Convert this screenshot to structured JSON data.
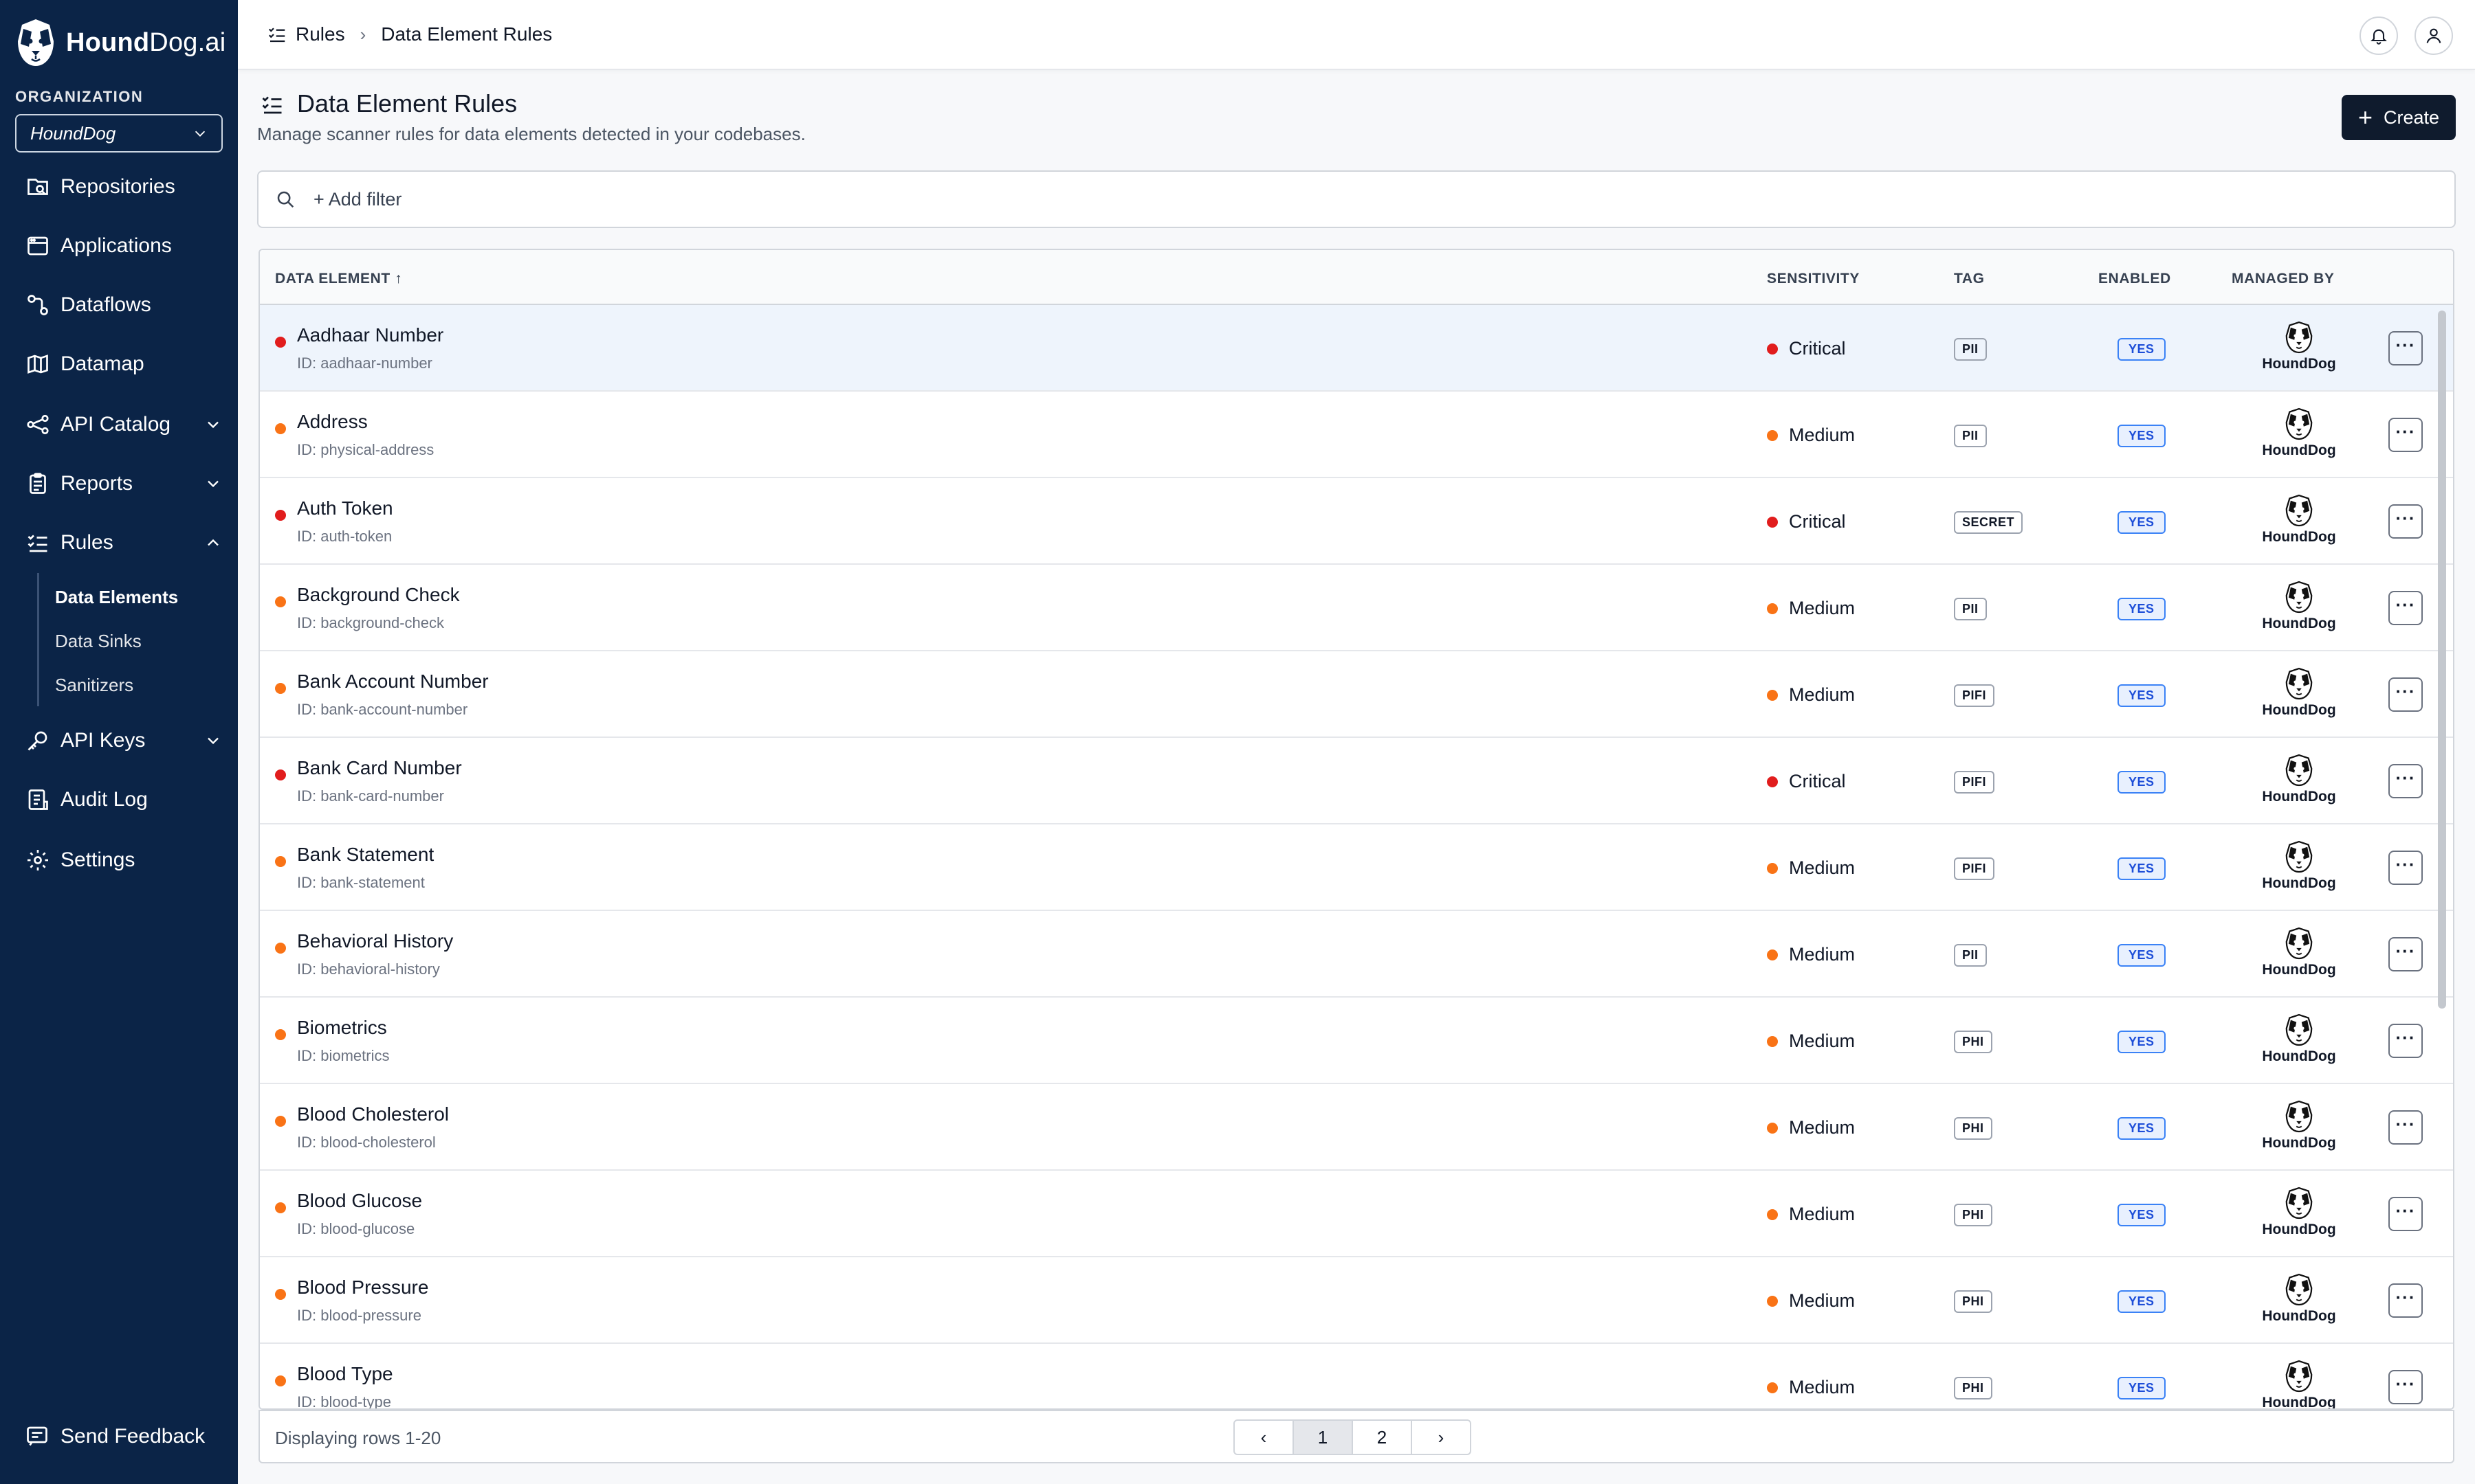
{
  "brand": {
    "name_bold": "Hound",
    "name_rest": "Dog.ai"
  },
  "org": {
    "label": "ORGANIZATION",
    "selected": "HoundDog"
  },
  "nav": [
    {
      "label": "Repositories"
    },
    {
      "label": "Applications"
    },
    {
      "label": "Dataflows"
    },
    {
      "label": "Datamap"
    },
    {
      "label": "API Catalog"
    },
    {
      "label": "Reports"
    },
    {
      "label": "Rules"
    },
    {
      "label": "API Keys"
    },
    {
      "label": "Audit Log"
    },
    {
      "label": "Settings"
    }
  ],
  "rules_sub": [
    {
      "label": "Data Elements"
    },
    {
      "label": "Data Sinks"
    },
    {
      "label": "Sanitizers"
    }
  ],
  "feedback": "Send Feedback",
  "breadcrumb": {
    "root": "Rules",
    "current": "Data Element Rules"
  },
  "page": {
    "title": "Data Element Rules",
    "subtitle": "Manage scanner rules for data elements detected in your codebases.",
    "create_label": "Create",
    "filter_placeholder": "+ Add filter"
  },
  "table": {
    "columns": [
      "DATA ELEMENT",
      "SENSITIVITY",
      "TAG",
      "ENABLED",
      "MANAGED BY"
    ],
    "rows": [
      {
        "name": "Aadhaar Number",
        "id": "ID: aadhaar-number",
        "sensitivity": "Critical",
        "tag": "PII",
        "enabled": "YES",
        "managed_by": "HoundDog"
      },
      {
        "name": "Address",
        "id": "ID: physical-address",
        "sensitivity": "Medium",
        "tag": "PII",
        "enabled": "YES",
        "managed_by": "HoundDog"
      },
      {
        "name": "Auth Token",
        "id": "ID: auth-token",
        "sensitivity": "Critical",
        "tag": "SECRET",
        "enabled": "YES",
        "managed_by": "HoundDog"
      },
      {
        "name": "Background Check",
        "id": "ID: background-check",
        "sensitivity": "Medium",
        "tag": "PII",
        "enabled": "YES",
        "managed_by": "HoundDog"
      },
      {
        "name": "Bank Account Number",
        "id": "ID: bank-account-number",
        "sensitivity": "Medium",
        "tag": "PIFI",
        "enabled": "YES",
        "managed_by": "HoundDog"
      },
      {
        "name": "Bank Card Number",
        "id": "ID: bank-card-number",
        "sensitivity": "Critical",
        "tag": "PIFI",
        "enabled": "YES",
        "managed_by": "HoundDog"
      },
      {
        "name": "Bank Statement",
        "id": "ID: bank-statement",
        "sensitivity": "Medium",
        "tag": "PIFI",
        "enabled": "YES",
        "managed_by": "HoundDog"
      },
      {
        "name": "Behavioral History",
        "id": "ID: behavioral-history",
        "sensitivity": "Medium",
        "tag": "PII",
        "enabled": "YES",
        "managed_by": "HoundDog"
      },
      {
        "name": "Biometrics",
        "id": "ID: biometrics",
        "sensitivity": "Medium",
        "tag": "PHI",
        "enabled": "YES",
        "managed_by": "HoundDog"
      },
      {
        "name": "Blood Cholesterol",
        "id": "ID: blood-cholesterol",
        "sensitivity": "Medium",
        "tag": "PHI",
        "enabled": "YES",
        "managed_by": "HoundDog"
      },
      {
        "name": "Blood Glucose",
        "id": "ID: blood-glucose",
        "sensitivity": "Medium",
        "tag": "PHI",
        "enabled": "YES",
        "managed_by": "HoundDog"
      },
      {
        "name": "Blood Pressure",
        "id": "ID: blood-pressure",
        "sensitivity": "Medium",
        "tag": "PHI",
        "enabled": "YES",
        "managed_by": "HoundDog"
      },
      {
        "name": "Blood Type",
        "id": "ID: blood-type",
        "sensitivity": "Medium",
        "tag": "PHI",
        "enabled": "YES",
        "managed_by": "HoundDog"
      }
    ]
  },
  "footer": {
    "rows_info": "Displaying rows 1-20",
    "pages": [
      "1",
      "2"
    ],
    "current_page": "1"
  },
  "colors": {
    "sidebar": "#0b2447",
    "critical": "#e11d1d",
    "medium": "#f97316",
    "enabled_blue": "#3b82f6",
    "create_btn": "#0f1b2d"
  }
}
